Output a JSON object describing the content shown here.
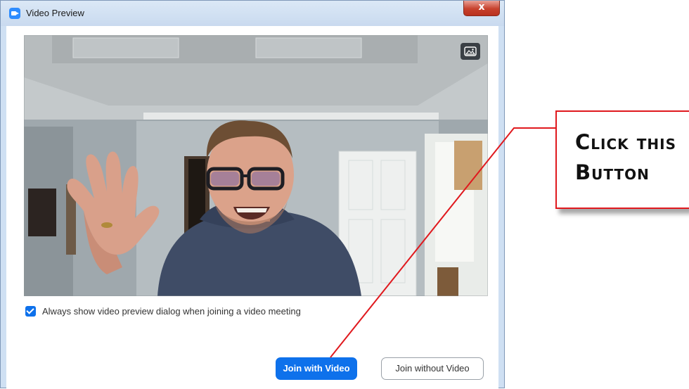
{
  "window": {
    "title": "Video Preview",
    "close_glyph": "x",
    "icon": "zoom-camera-icon"
  },
  "video_preview": {
    "overlay_icon": "image-icon"
  },
  "options": {
    "always_show_preview_label": "Always show video preview dialog when joining a video meeting",
    "always_show_preview_checked": true
  },
  "actions": {
    "join_with_video_label": "Join with Video",
    "join_without_video_label": "Join without Video"
  },
  "annotation": {
    "line1": "Click this",
    "line2": "Button",
    "border_color": "#e0191e"
  },
  "colors": {
    "accent": "#0e71eb",
    "annotation_red": "#e0191e"
  }
}
